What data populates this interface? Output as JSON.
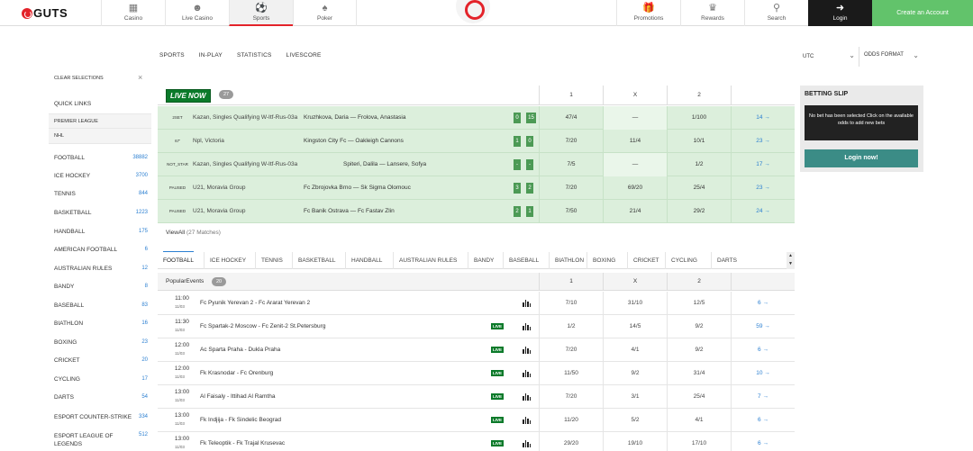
{
  "brand": {
    "name": "GUTS",
    "accent": "#e3232a",
    "green": "#62c36b",
    "live_green": "#0b7a2a"
  },
  "topnav": {
    "tabs": [
      {
        "label": "Casino",
        "icon": "slot-machine-icon"
      },
      {
        "label": "Live Casino",
        "icon": "dealer-icon"
      },
      {
        "label": "Sports",
        "icon": "soccer-ball-icon"
      },
      {
        "label": "Poker",
        "icon": "cards-icon"
      }
    ],
    "right_tabs": [
      {
        "label": "Promotions",
        "icon": "gift-icon"
      },
      {
        "label": "Rewards",
        "icon": "trophy-icon"
      },
      {
        "label": "Search",
        "icon": "search-icon"
      }
    ],
    "login_label": "Login",
    "create_label": "Create an Account"
  },
  "subnav": {
    "items": [
      "SPORTS",
      "IN-PLAY",
      "STATISTICS",
      "LIVESCORE"
    ],
    "timezone": "UTC",
    "odds_format": "ODDS FORMAT"
  },
  "sidebar": {
    "clear_label": "CLEAR SELECTIONS",
    "quick_links_label": "QUICK LINKS",
    "quick_links": [
      "PREMIER LEAGUE",
      "NHL"
    ],
    "sports": [
      {
        "name": "FOOTBALL",
        "count": "38882"
      },
      {
        "name": "ICE HOCKEY",
        "count": "3700"
      },
      {
        "name": "TENNIS",
        "count": "844"
      },
      {
        "name": "BASKETBALL",
        "count": "1223"
      },
      {
        "name": "HANDBALL",
        "count": "175"
      },
      {
        "name": "AMERICAN FOOTBALL",
        "count": "6"
      },
      {
        "name": "AUSTRALIAN RULES",
        "count": "12"
      },
      {
        "name": "BANDY",
        "count": "8"
      },
      {
        "name": "BASEBALL",
        "count": "83"
      },
      {
        "name": "BIATHLON",
        "count": "16"
      },
      {
        "name": "BOXING",
        "count": "23"
      },
      {
        "name": "CRICKET",
        "count": "20"
      },
      {
        "name": "CYCLING",
        "count": "17"
      },
      {
        "name": "DARTS",
        "count": "54"
      },
      {
        "name": "ESPORT COUNTER-STRIKE",
        "count": "334"
      },
      {
        "name": "ESPORT LEAGUE OF LEGENDS",
        "count": "512"
      }
    ]
  },
  "live": {
    "badge": "LIVE NOW",
    "count": "27",
    "cols": [
      "1",
      "X",
      "2"
    ],
    "rows": [
      {
        "status": "2SET",
        "league": "Kazan, Singles Qualifying W-Itf-Rus-03a",
        "match": "Kruzhkova, Daria — Frolova, Anastasia",
        "s1": "0",
        "s2": "15",
        "o1": "47/4",
        "ox": "—",
        "o2": "1/100",
        "more": "14 →"
      },
      {
        "status": "67'",
        "league": "Npl, Victoria",
        "match": "Kingston City Fc — Oakleigh Cannons",
        "s1": "1",
        "s2": "0",
        "o1": "7/20",
        "ox": "11/4",
        "o2": "10/1",
        "more": "23 →"
      },
      {
        "status": "NOT_STAR",
        "league": "Kazan, Singles Qualifying W-Itf-Rus-03a",
        "match": "Spiteri, Dalila — Lansere, Sofya",
        "s1": "-",
        "s2": "-",
        "o1": "7/5",
        "ox": "—",
        "o2": "1/2",
        "more": "17 →"
      },
      {
        "status": "PAUSED",
        "league": "U21, Moravia Group",
        "match": "Fc Zbrojovka Brno — Sk Sigma Olomouc",
        "s1": "3",
        "s2": "2",
        "o1": "7/20",
        "ox": "69/20",
        "o2": "25/4",
        "more": "23 →"
      },
      {
        "status": "PAUSED",
        "league": "U21, Moravia Group",
        "match": "Fc Banik Ostrava — Fc Fastav Zlin",
        "s1": "2",
        "s2": "1",
        "o1": "7/50",
        "ox": "21/4",
        "o2": "29/2",
        "more": "24 →"
      }
    ],
    "view_all": "ViewAll",
    "view_all_count": "(27 Matches)"
  },
  "sport_tabs": [
    "FOOTBALL",
    "ICE HOCKEY",
    "TENNIS",
    "BASKETBALL",
    "HANDBALL",
    "AUSTRALIAN RULES",
    "BANDY",
    "BASEBALL",
    "BIATHLON",
    "BOXING",
    "CRICKET",
    "CYCLING",
    "DARTS"
  ],
  "events": {
    "title": "PopularEvents",
    "count": "20",
    "cols": [
      "1",
      "X",
      "2"
    ],
    "rows": [
      {
        "time": "11:00",
        "date": "11/03",
        "match": "Fc Pyunik Yerevan 2 - Fc Ararat Yerevan 2",
        "live": "",
        "o1": "7/10",
        "ox": "31/10",
        "o2": "12/5",
        "more": "6 →"
      },
      {
        "time": "11:30",
        "date": "11/03",
        "match": "Fc Spartak-2 Moscow - Fc Zenit-2 St.Petersburg",
        "live": "LIVE",
        "o1": "1/2",
        "ox": "14/5",
        "o2": "9/2",
        "more": "59 →"
      },
      {
        "time": "12:00",
        "date": "11/03",
        "match": "Ac Sparta Praha - Dukla Praha",
        "live": "LIVE",
        "o1": "7/20",
        "ox": "4/1",
        "o2": "9/2",
        "more": "6 →"
      },
      {
        "time": "12:00",
        "date": "11/03",
        "match": "Fk Krasnodar - Fc Orenburg",
        "live": "LIVE",
        "o1": "11/50",
        "ox": "9/2",
        "o2": "31/4",
        "more": "10 →"
      },
      {
        "time": "13:00",
        "date": "11/03",
        "match": "Al Faisaly - Ittihad Al Ramtha",
        "live": "LIVE",
        "o1": "7/20",
        "ox": "3/1",
        "o2": "25/4",
        "more": "7 →"
      },
      {
        "time": "13:00",
        "date": "11/03",
        "match": "Fk Indjija - Fk Sindelic Beograd",
        "live": "LIVE",
        "o1": "11/20",
        "ox": "5/2",
        "o2": "4/1",
        "more": "6 →"
      },
      {
        "time": "13:00",
        "date": "11/03",
        "match": "Fk Teleoptik - Fk Trajal Krusevac",
        "live": "LIVE",
        "o1": "29/20",
        "ox": "19/10",
        "o2": "17/10",
        "more": "6 →"
      }
    ]
  },
  "betslip": {
    "title": "BETTING SLIP",
    "message": "No bet has been selected Click on the available odds to add new bets",
    "button": "Login now!"
  }
}
